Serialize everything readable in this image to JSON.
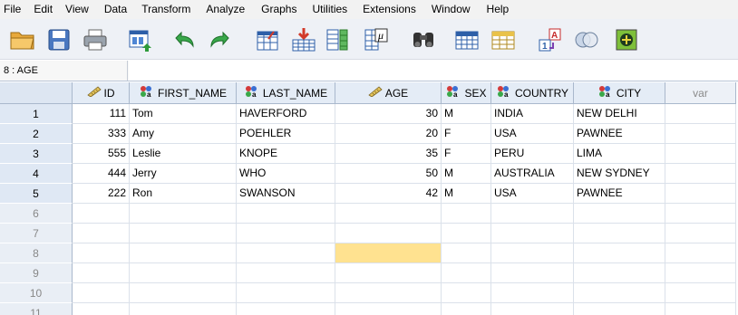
{
  "menu": [
    "File",
    "Edit",
    "View",
    "Data",
    "Transform",
    "Analyze",
    "Graphs",
    "Utilities",
    "Extensions",
    "Window",
    "Help"
  ],
  "toolbar": {
    "icons": [
      "open-folder-icon",
      "save-icon",
      "print-icon",
      "recall-dialog-icon",
      "undo-icon",
      "redo-icon",
      "go-to-case-icon",
      "insert-cases-icon",
      "variables-icon",
      "value-labels-icon",
      "find-icon",
      "insert-variable-icon",
      "split-file-icon",
      "weight-cases-icon",
      "select-cases-icon",
      "use-variable-sets-icon"
    ]
  },
  "cell_ref": {
    "reference": "8 : AGE",
    "value": ""
  },
  "columns": [
    {
      "name": "ID",
      "type": "scale"
    },
    {
      "name": "FIRST_NAME",
      "type": "nominal"
    },
    {
      "name": "LAST_NAME",
      "type": "nominal"
    },
    {
      "name": "AGE",
      "type": "scale"
    },
    {
      "name": "SEX",
      "type": "nominal"
    },
    {
      "name": "COUNTRY",
      "type": "nominal"
    },
    {
      "name": "CITY",
      "type": "nominal"
    },
    {
      "name": "var",
      "type": "empty"
    }
  ],
  "rows": [
    {
      "row": "1",
      "cells": [
        "111",
        "Tom",
        "HAVERFORD",
        "30",
        "M",
        "INDIA",
        "NEW DELHI",
        ""
      ]
    },
    {
      "row": "2",
      "cells": [
        "333",
        "Amy",
        "POEHLER",
        "20",
        "F",
        "USA",
        "PAWNEE",
        ""
      ]
    },
    {
      "row": "3",
      "cells": [
        "555",
        "Leslie",
        "KNOPE",
        "35",
        "F",
        "PERU",
        "LIMA",
        ""
      ]
    },
    {
      "row": "4",
      "cells": [
        "444",
        "Jerry",
        "WHO",
        "50",
        "M",
        "AUSTRALIA",
        "NEW SYDNEY",
        ""
      ]
    },
    {
      "row": "5",
      "cells": [
        "222",
        "Ron",
        "SWANSON",
        "42",
        "M",
        "USA",
        "PAWNEE",
        ""
      ]
    },
    {
      "row": "6",
      "cells": [
        "",
        "",
        "",
        "",
        "",
        "",
        "",
        ""
      ]
    },
    {
      "row": "7",
      "cells": [
        "",
        "",
        "",
        "",
        "",
        "",
        "",
        ""
      ]
    },
    {
      "row": "8",
      "cells": [
        "",
        "",
        "",
        "",
        "",
        "",
        "",
        ""
      ]
    },
    {
      "row": "9",
      "cells": [
        "",
        "",
        "",
        "",
        "",
        "",
        "",
        ""
      ]
    },
    {
      "row": "10",
      "cells": [
        "",
        "",
        "",
        "",
        "",
        "",
        "",
        ""
      ]
    },
    {
      "row": "11",
      "cells": [
        "",
        "",
        "",
        "",
        "",
        "",
        "",
        ""
      ]
    }
  ],
  "active_cell": {
    "row": "8",
    "column": "AGE"
  },
  "colors": {
    "header_bg": "#e4ecf6",
    "selected_cell": "#ffe290",
    "grid_line": "#dbe1ea"
  }
}
